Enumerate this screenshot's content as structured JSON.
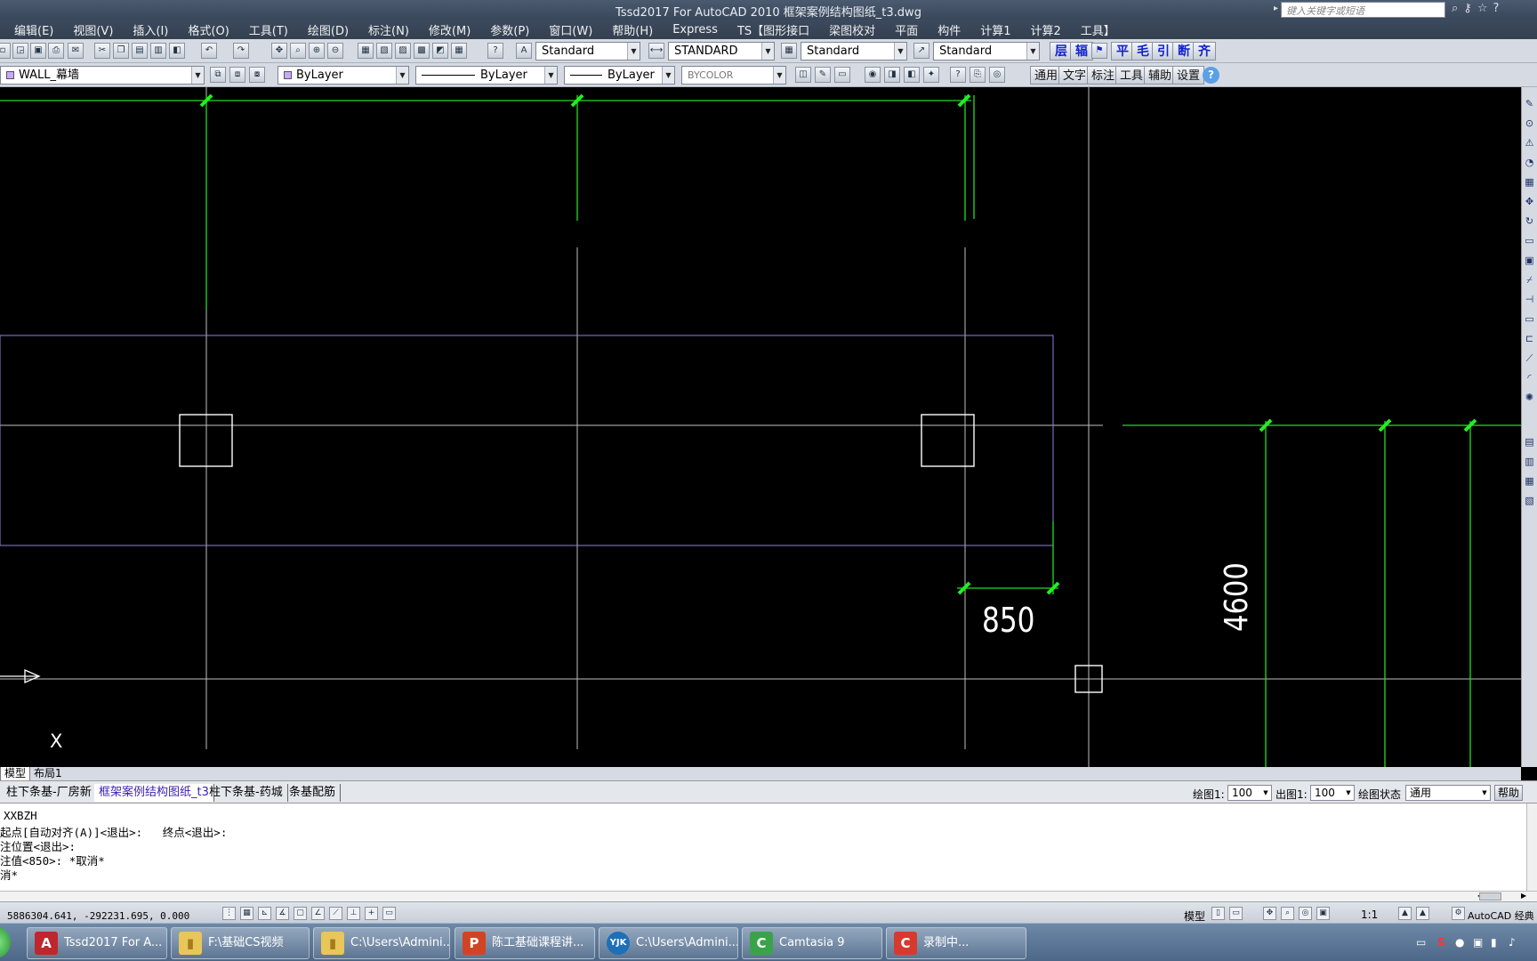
{
  "window": {
    "title": "Tssd2017 For AutoCAD 2010    框架案例结构图纸_t3.dwg",
    "search_placeholder": "键入关键字或短语"
  },
  "menu": [
    "编辑(E)",
    "视图(V)",
    "插入(I)",
    "格式(O)",
    "工具(T)",
    "绘图(D)",
    "标注(N)",
    "修改(M)",
    "参数(P)",
    "窗口(W)",
    "帮助(H)",
    "Express",
    "TS【图形接口",
    "梁图校对",
    "平面",
    "构件",
    "计算1",
    "计算2",
    "工具】"
  ],
  "toolbar1": {
    "text_style": "Standard",
    "dim_style": "STANDARD",
    "table_style": "Standard",
    "multileader_style": "Standard",
    "ts_buttons": [
      "层",
      "辐",
      "平",
      "毛",
      "引",
      "断",
      "齐"
    ]
  },
  "toolbar2": {
    "layer": "WALL_幕墙",
    "color": "ByLayer",
    "linetype": "ByLayer",
    "lineweight": "ByLayer",
    "plotstyle": "BYCOLOR",
    "tab_buttons": [
      "通用",
      "文字",
      "标注",
      "工具",
      "辅助",
      "设置"
    ]
  },
  "drawing": {
    "dim_850": "850",
    "dim_4600": "4600",
    "ucs_axis": "X"
  },
  "layout_tabs": {
    "model": "模型",
    "layout1": "布局1"
  },
  "file_tabs": [
    "柱下条基-厂房新",
    "框架案例结构图纸_t3",
    "柱下条基-药城",
    "条基配筋"
  ],
  "scale_bar": {
    "draw_scale_label": "绘图1:",
    "draw_scale": "100",
    "out_scale_label": "出图1:",
    "out_scale": "100",
    "state_label": "绘图状态",
    "state": "通用",
    "help": "帮助"
  },
  "command_lines": [
    "XXBZH",
    "起点[自动对齐(A)]<退出>:   终点<退出>:",
    "注位置<退出>:",
    "注值<850>: *取消*",
    "消*"
  ],
  "status": {
    "coords": "5886304.641, -292231.695, 0.000",
    "model_label": "模型",
    "scale": "1:1",
    "app_label": "AutoCAD 经典"
  },
  "taskbar": [
    {
      "label": "Tssd2017 For A...",
      "icon": "autocad-icon",
      "icon_char": "A",
      "color": "#c0262d"
    },
    {
      "label": "F:\\基础CS视频",
      "icon": "folder-icon",
      "icon_char": "▮",
      "color": "#e8c65a"
    },
    {
      "label": "C:\\Users\\Admini...",
      "icon": "folder-icon",
      "icon_char": "▮",
      "color": "#e8c65a"
    },
    {
      "label": "陈工基础课程讲...",
      "icon": "powerpoint-icon",
      "icon_char": "P",
      "color": "#d04423"
    },
    {
      "label": "C:\\Users\\Admini...",
      "icon": "yjk-icon",
      "icon_char": "YJK",
      "color": "#1d6fb8"
    },
    {
      "label": "Camtasia 9",
      "icon": "camtasia-icon",
      "icon_char": "C",
      "color": "#3aa34a"
    },
    {
      "label": "录制中...",
      "icon": "recorder-icon",
      "icon_char": "C",
      "color": "#d63a2e"
    }
  ]
}
